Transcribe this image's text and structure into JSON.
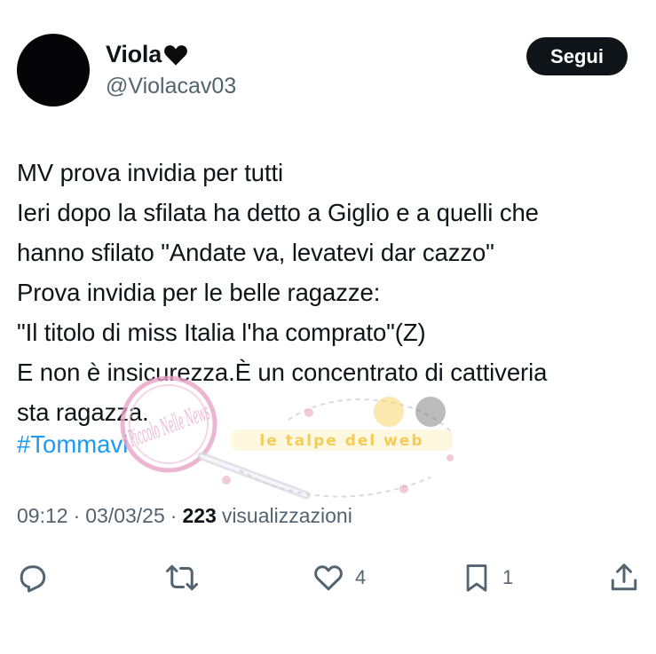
{
  "author": {
    "display_name": "Viola",
    "handle": "@Violacav03"
  },
  "follow_label": "Segui",
  "body_lines": [
    "MV prova invidia per tutti",
    "Ieri dopo la sfilata ha detto a Giglio e a quelli che",
    "hanno sfilato \"Andate va, levatevi dar cazzo\"",
    "Prova invidia per le belle ragazze:",
    "\"Il titolo di miss Italia l'ha comprato\"(Z)",
    "E non è insicurezza.È un concentrato di cattiveria",
    "sta ragazza."
  ],
  "hashtag": "#Tommavi",
  "meta": {
    "time": "09:12",
    "date": "03/03/25",
    "views_count": "223",
    "views_label": "visualizzazioni"
  },
  "actions": {
    "reply_icon": "reply-icon",
    "repost_icon": "repost-icon",
    "like_icon": "like-icon",
    "like_count": "4",
    "bookmark_icon": "bookmark-icon",
    "bookmark_count": "1",
    "share_icon": "share-icon"
  },
  "watermark": {
    "stamp_text": "Piccolo Nelle News",
    "banner_text": "le talpe del web"
  },
  "colors": {
    "text": "#0f1419",
    "secondary": "#536471",
    "link": "#1d9bf0",
    "button_bg": "#0f1419",
    "watermark_pink": "#e7a3c6",
    "watermark_yellow": "#f5c542"
  }
}
